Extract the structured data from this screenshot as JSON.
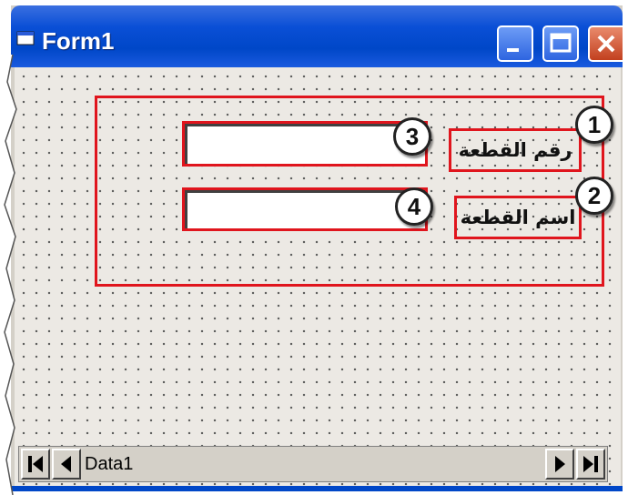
{
  "window": {
    "title": "Form1"
  },
  "form": {
    "label_part_number": "رقم القطعة",
    "label_part_name": "اسم القطعة",
    "textbox_part_number_value": "",
    "textbox_part_name_value": ""
  },
  "callouts": [
    "1",
    "2",
    "3",
    "4"
  ],
  "data_control": {
    "caption": "Data1"
  },
  "colors": {
    "highlight": "#e0151d",
    "titlebar": "#0a4fd6",
    "form_bg": "#ece9e4"
  },
  "icons": [
    "form-icon",
    "minimize-icon",
    "maximize-icon",
    "close-icon",
    "move-first-icon",
    "move-previous-icon",
    "move-next-icon",
    "move-last-icon"
  ]
}
